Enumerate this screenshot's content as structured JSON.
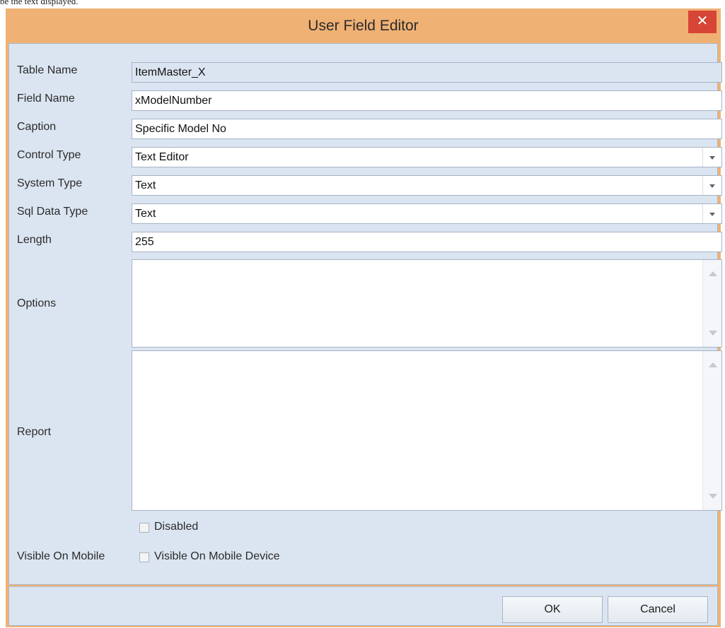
{
  "top_text": "be the text displayed.",
  "window": {
    "title": "User Field Editor",
    "close_glyph": "✕"
  },
  "form": {
    "table_name": {
      "label": "Table Name",
      "value": "ItemMaster_X"
    },
    "field_name": {
      "label": "Field Name",
      "value": "xModelNumber"
    },
    "caption": {
      "label": "Caption",
      "value": "Specific Model No"
    },
    "control_type": {
      "label": "Control Type",
      "value": "Text Editor"
    },
    "system_type": {
      "label": "System Type",
      "value": "Text"
    },
    "sql_data_type": {
      "label": "Sql Data Type",
      "value": "Text"
    },
    "length": {
      "label": "Length",
      "value": "255"
    },
    "options": {
      "label": "Options",
      "value": ""
    },
    "report": {
      "label": "Report",
      "value": ""
    },
    "disabled": {
      "label": "Disabled",
      "checked": false
    },
    "visible_on_mobile": {
      "row_label": "Visible On Mobile",
      "label": "Visible On Mobile Device",
      "checked": false
    }
  },
  "buttons": {
    "ok": "OK",
    "cancel": "Cancel"
  },
  "colors": {
    "title_bar": "#f0b174",
    "client_bg": "#dbe5f1",
    "close_button": "#d64536"
  }
}
